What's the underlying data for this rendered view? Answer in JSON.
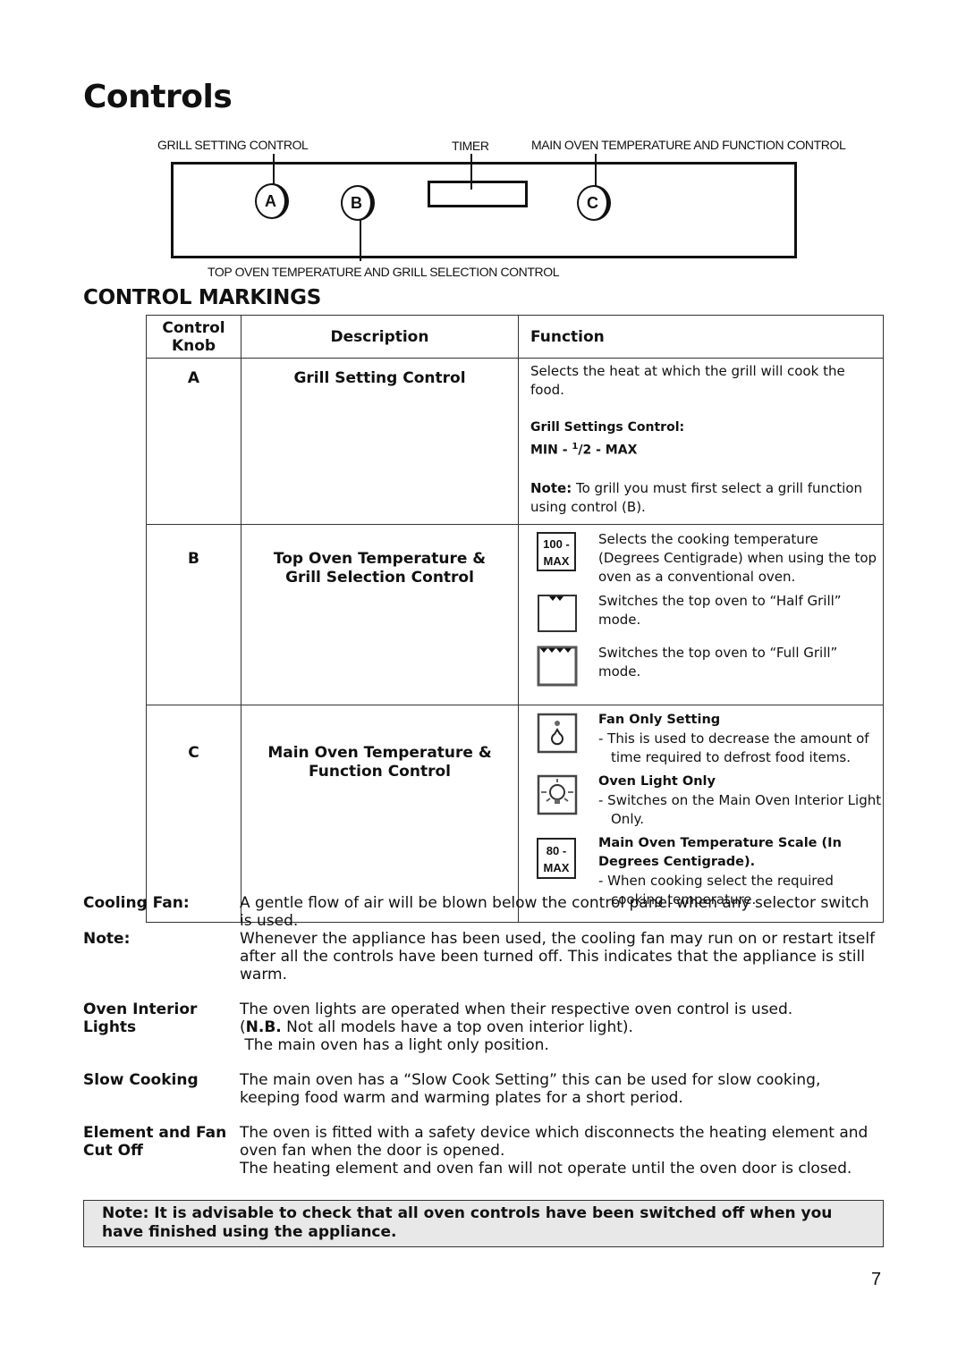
{
  "page": {
    "title": "Controls",
    "page_number": "7"
  },
  "diagram": {
    "labels": {
      "grill_setting": "GRILL SETTING CONTROL",
      "timer": "TIMER",
      "main_oven": "MAIN OVEN TEMPERATURE AND FUNCTION CONTROL",
      "top_oven": "TOP OVEN TEMPERATURE AND GRILL SELECTION CONTROL"
    },
    "knobs": [
      "A",
      "B",
      "C"
    ]
  },
  "markings": {
    "heading": "CONTROL MARKINGS",
    "columns": {
      "knob": "Control Knob",
      "description": "Description",
      "function": "Function"
    },
    "rows": [
      {
        "knob": "A",
        "description": "Grill Setting Control",
        "function_text": "Selects the heat at which the grill will cook the food.",
        "settings_label": "Grill Settings Control:",
        "settings_min": "MIN - ",
        "settings_half_num": "1",
        "settings_half_den": "/2 - MAX",
        "note_label": "Note:",
        "note_text": " To grill you must first select a grill function using control (B)."
      },
      {
        "knob": "B",
        "description_line1": "Top Oven Temperature &",
        "description_line2": "Grill Selection Control",
        "items": [
          {
            "icon": "temperature-scale-icon",
            "scale_top": "100 -",
            "scale_bottom": "MAX",
            "text": "Selects the cooking temperature (Degrees Centigrade) when using the top oven as a conventional oven."
          },
          {
            "icon": "half-grill-icon",
            "text": "Switches the top oven to “Half Grill” mode."
          },
          {
            "icon": "full-grill-icon",
            "text": "Switches the top oven to “Full Grill” mode."
          }
        ]
      },
      {
        "knob": "C",
        "description_line1": "Main Oven Temperature &",
        "description_line2": "Function Control",
        "items": [
          {
            "icon": "fan-only-icon",
            "heading": "Fan Only Setting",
            "text": "- This is used to decrease the amount of time required to defrost food items."
          },
          {
            "icon": "oven-light-icon",
            "heading": "Oven Light Only",
            "text": "- Switches on the Main Oven Interior Light Only."
          },
          {
            "icon": "temperature-scale-icon",
            "scale_top": "80 -",
            "scale_bottom": "MAX",
            "heading": "Main Oven Temperature Scale (In Degrees Centigrade).",
            "text": "- When cooking select the required cooking temperature."
          }
        ]
      }
    ]
  },
  "notes": [
    {
      "label": "Cooling Fan:",
      "lines": [
        "A gentle flow of air will be blown below the control panel when any selector switch is used."
      ]
    },
    {
      "label": "Note:",
      "lines": [
        "Whenever the appliance has been used, the cooling fan may run on or restart itself after all the controls have been turned off. This indicates that the appliance is still warm."
      ]
    },
    {
      "label": "Oven Interior Lights",
      "lines": [
        "The oven lights are operated when their respective oven control is used."
      ],
      "nb_label": "N.B.",
      "nb_text": " Not all models have a top oven interior light).",
      "extra": " The main oven has a light only position."
    },
    {
      "label": "Slow Cooking",
      "lines": [
        "The main oven  has a “Slow Cook Setting” this can be used for slow cooking, keeping food warm and warming plates for a short period."
      ]
    },
    {
      "label": "Element and Fan Cut Off",
      "lines": [
        "The oven is fitted with a safety device which disconnects the heating element and oven fan when the door is opened.",
        "The heating element and oven fan will not operate until the oven door is closed."
      ]
    }
  ],
  "warning": "Note: It is advisable to check that all oven controls have been switched off when you have finished using the appliance."
}
